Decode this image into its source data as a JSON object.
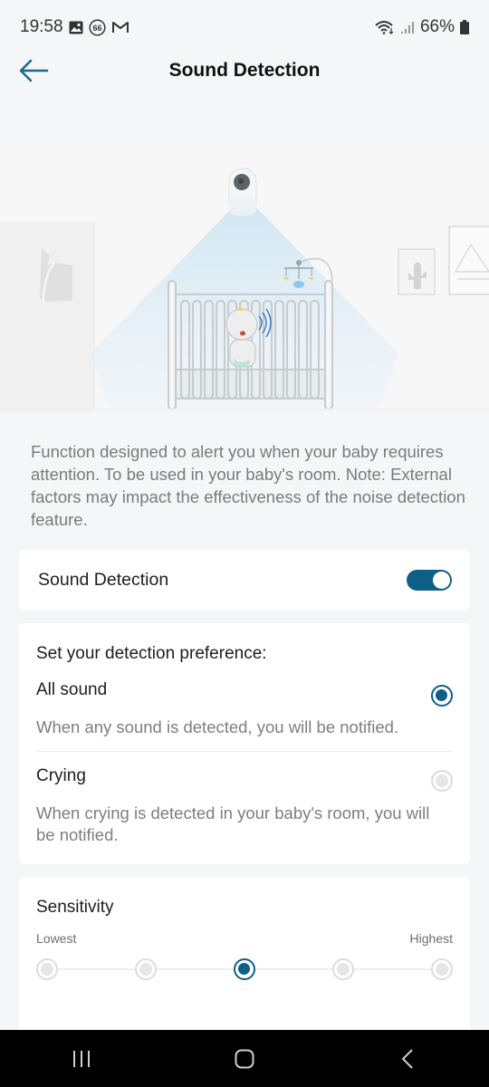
{
  "status_bar": {
    "time": "19:58",
    "left_icons": [
      "gallery-icon",
      "badge-66-icon",
      "gmail-icon"
    ],
    "badge_text": "66",
    "right_icons": [
      "wifi-icon",
      "signal-icon",
      "battery-icon"
    ],
    "battery": "66%"
  },
  "header": {
    "title": "Sound Detection",
    "back_icon": "arrow-left-icon"
  },
  "hero": {
    "illustration": "baby-monitor-nursery-illustration"
  },
  "intro_text": "Function designed to alert you when your baby requires attention. To be used in your baby's room. Note: External factors may impact the effectiveness of the noise detection feature.",
  "sound_detection": {
    "label": "Sound Detection",
    "enabled": true
  },
  "preference": {
    "heading": "Set your detection preference:",
    "options": [
      {
        "title": "All sound",
        "description": "When any sound is detected, you will be notified.",
        "selected": true
      },
      {
        "title": "Crying",
        "description": "When crying is detected in your baby's room, you will be notified.",
        "selected": false
      }
    ]
  },
  "sensitivity": {
    "title": "Sensitivity",
    "low_label": "Lowest",
    "high_label": "Highest",
    "levels": 5,
    "selected_level": 3
  },
  "colors": {
    "accent": "#0e5f86",
    "background": "#f5f6f8",
    "card": "#ffffff",
    "secondary_text": "#7e7e7e"
  },
  "nav_bar": {
    "buttons": [
      "recent-apps",
      "home",
      "back"
    ]
  }
}
